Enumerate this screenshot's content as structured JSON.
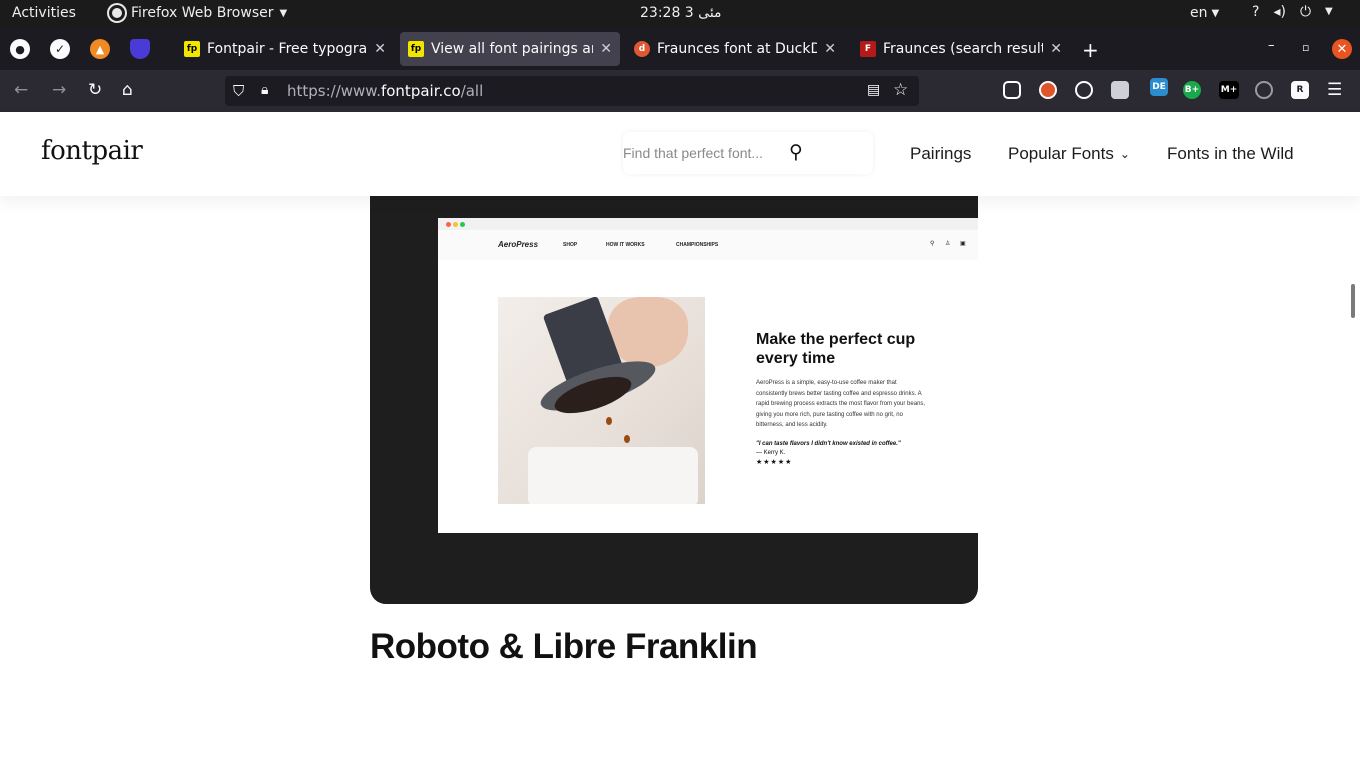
{
  "system": {
    "activities": "Activities",
    "app_name": "Firefox Web Browser",
    "clock": "23:28  3 مئی",
    "lang": "en"
  },
  "tabs": [
    {
      "title": "Fontpair - Free typograph",
      "favicon": "fp",
      "active": false
    },
    {
      "title": "View all font pairings anc",
      "favicon": "fp",
      "active": true
    },
    {
      "title": "Fraunces font at DuckDu",
      "favicon": "duckduckgo",
      "active": false
    },
    {
      "title": "Fraunces (search results)",
      "favicon": "F",
      "active": false
    }
  ],
  "pinned_tabs": [
    "github-icon",
    "checkmark-icon",
    "fire-icon",
    "shield-icon"
  ],
  "browser": {
    "url_prefix": "https://www.",
    "url_domain": "fontpair.co",
    "url_path": "/all"
  },
  "extensions": [
    {
      "name": "pocket-icon",
      "label": ""
    },
    {
      "name": "ublock-icon",
      "label": ""
    },
    {
      "name": "extension-icon",
      "label": ""
    },
    {
      "name": "picture-icon",
      "label": ""
    },
    {
      "name": "translate-icon",
      "label": "DE"
    },
    {
      "name": "grammar-icon",
      "label": "B+"
    },
    {
      "name": "markdown-icon",
      "label": "M+"
    },
    {
      "name": "circle-icon",
      "label": ""
    },
    {
      "name": "readability-icon",
      "label": "R"
    }
  ],
  "site": {
    "logo": "fontpair",
    "search_placeholder": "Find that perfect font...",
    "nav": {
      "pairings": "Pairings",
      "popular_fonts": "Popular Fonts",
      "fonts_in_wild": "Fonts in the Wild"
    }
  },
  "preview": {
    "brand": "AeroPress",
    "nav_items": [
      "SHOP",
      "HOW IT WORKS",
      "CHAMPIONSHIPS"
    ],
    "headline": "Make the perfect cup every time",
    "body": "AeroPress is a simple, easy-to-use coffee maker that consistently brews better tasting coffee and espresso drinks. A rapid brewing process extracts the most flavor from your beans, giving you more rich, pure tasting coffee with no grit, no bitterness, and less acidity.",
    "quote": "\"I can taste flavors I didn't know existed in coffee.\"",
    "attribution": "— Kerry K.",
    "stars": "★★★★★"
  },
  "pairing_title": "Roboto & Libre Franklin"
}
